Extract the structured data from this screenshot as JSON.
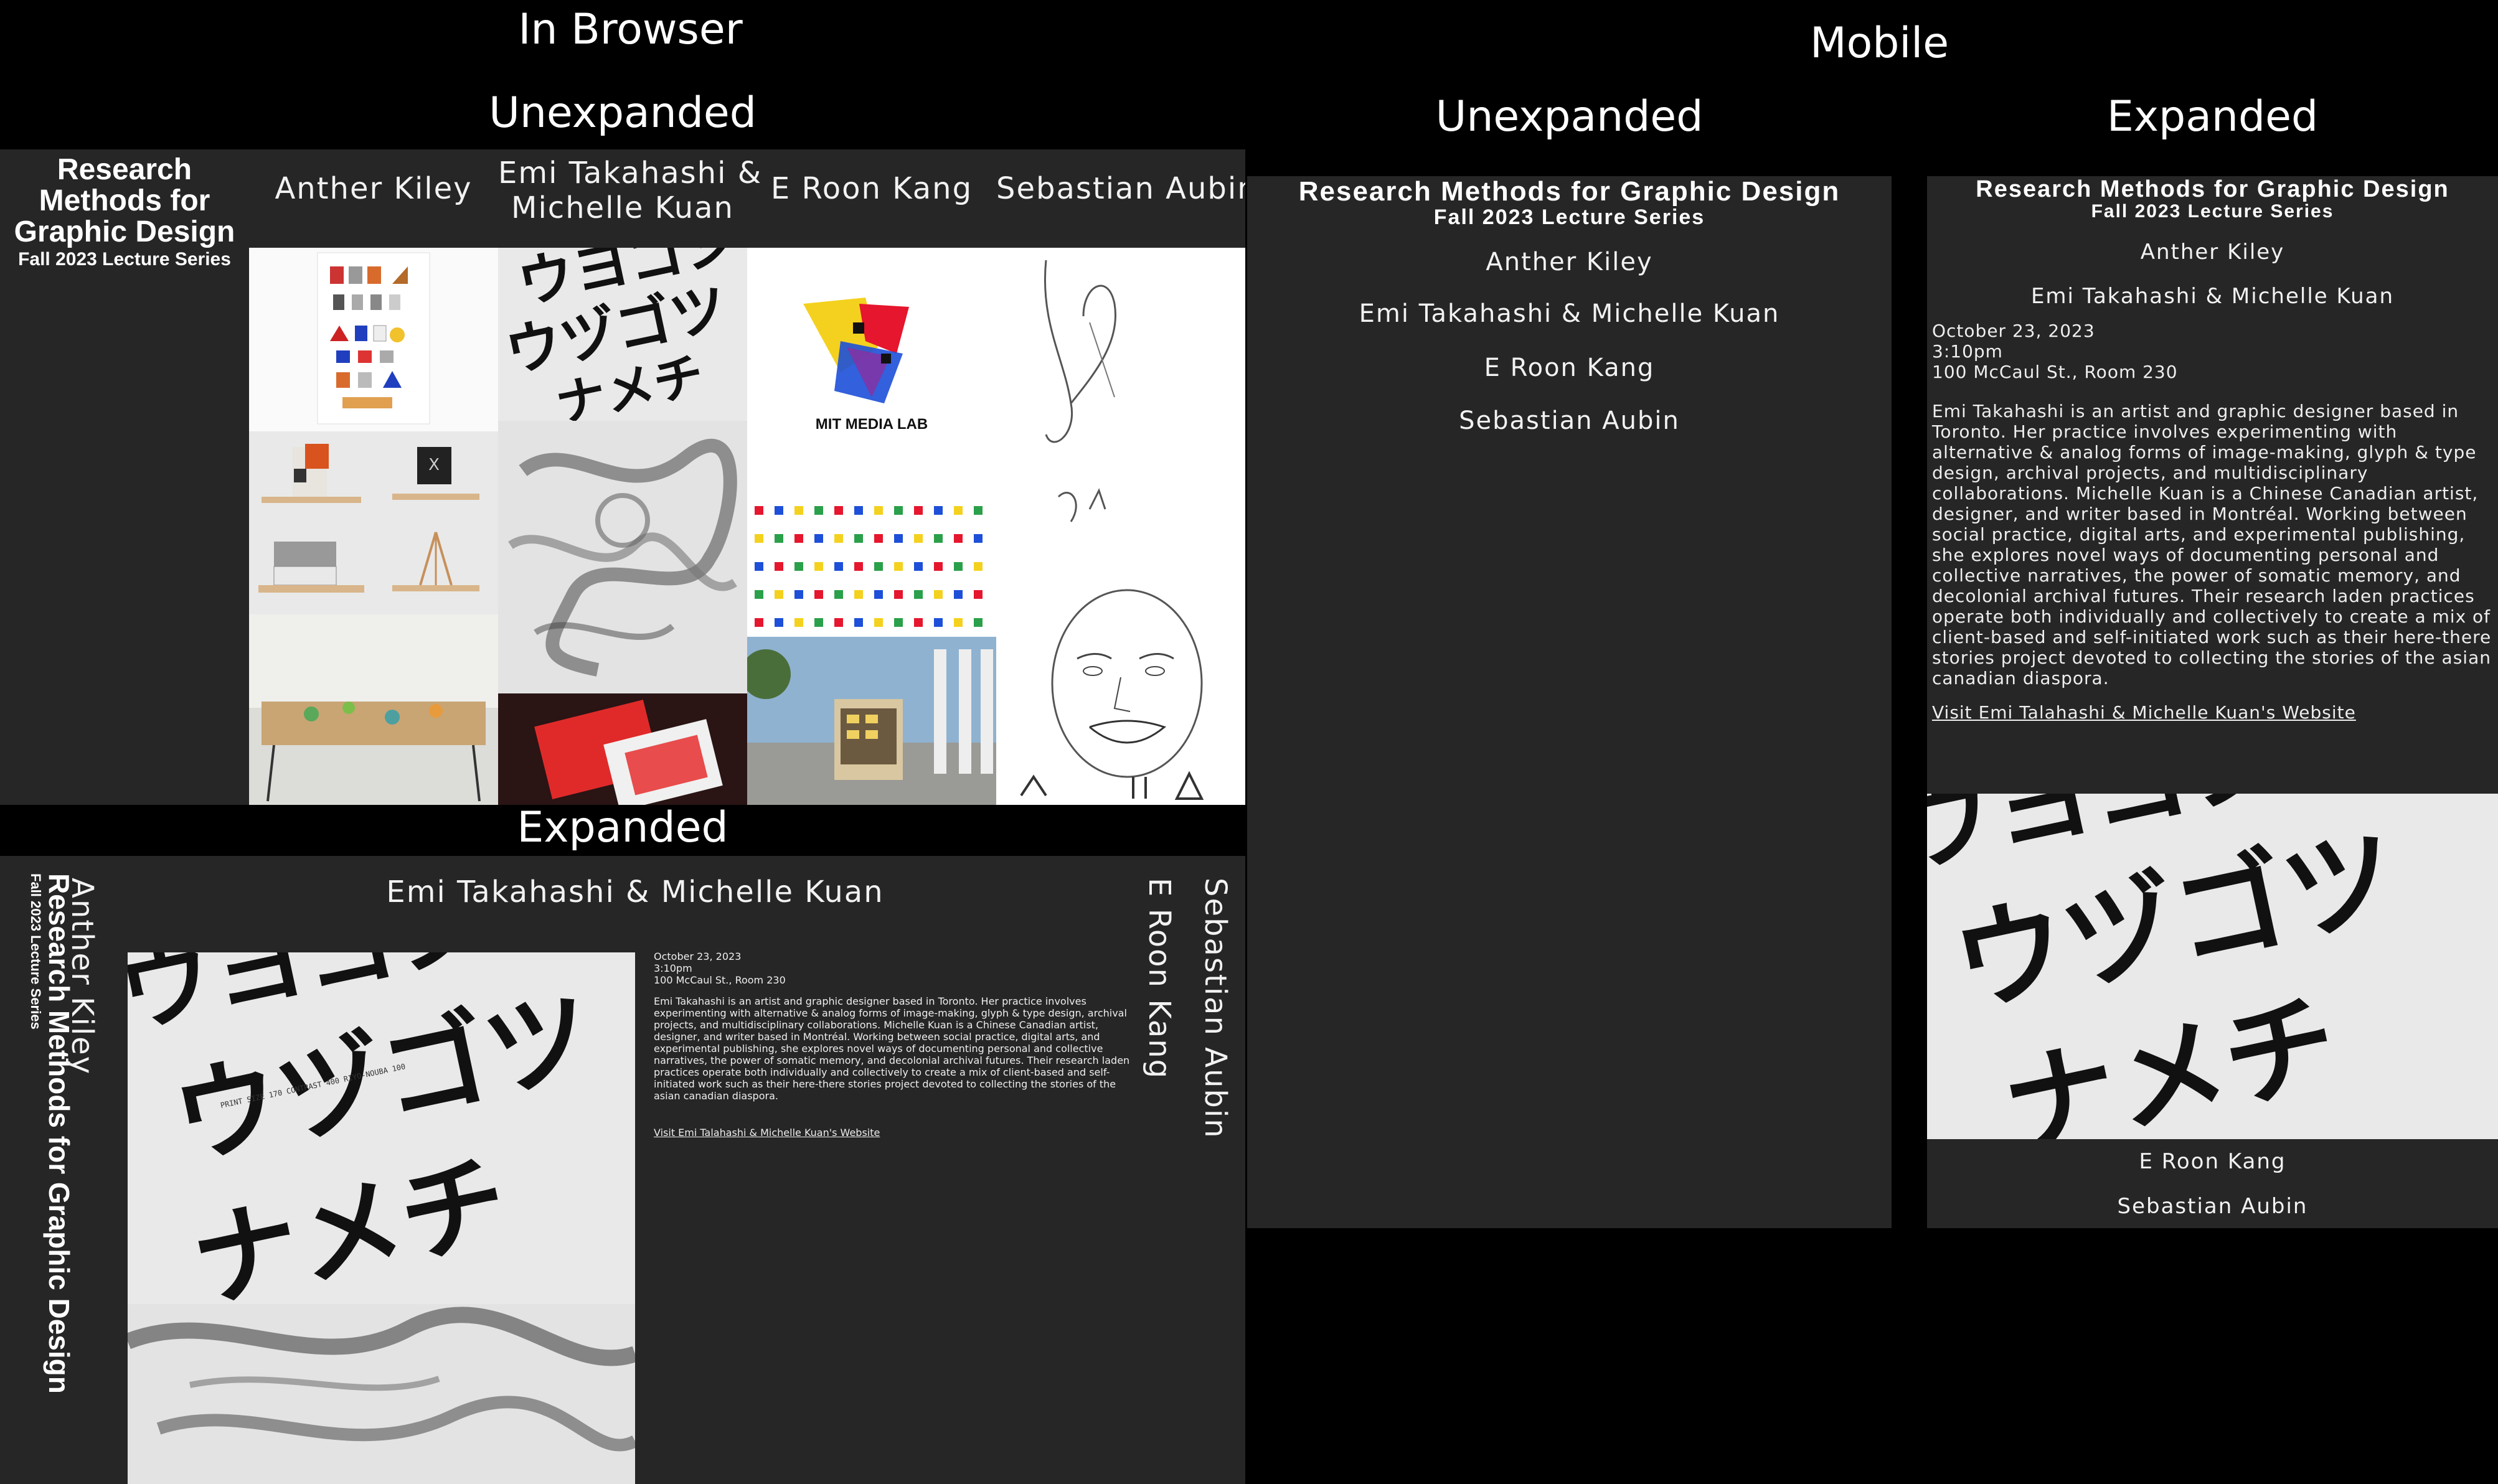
{
  "section_labels": {
    "in_browser": "In Browser",
    "mobile": "Mobile",
    "browser_unexpanded": "Unexpanded",
    "browser_expanded": "Expanded",
    "mobile_unexpanded": "Unexpanded",
    "mobile_expanded": "Expanded"
  },
  "site": {
    "title_lines": [
      "Research",
      "Methods for",
      "Graphic Design"
    ],
    "title_full": "Research Methods for Graphic Design",
    "subtitle": "Fall 2023 Lecture Series"
  },
  "speakers": {
    "s1": "Anther Kiley",
    "s2": "Emi Takahashi & Michelle Kuan",
    "s2_line1": "Emi Takahashi &",
    "s2_line2": "Michelle Kuan",
    "s3": "E Roon Kang",
    "s4": "Sebastian Aubin"
  },
  "event": {
    "date": "October 23, 2023",
    "time": "3:10pm",
    "location": "100 McCaul St., Room 230",
    "bio": "Emi Takahashi is an artist and graphic designer based in Toronto. Her practice involves experimenting with alternative & analog forms of image-making, glyph & type design, archival projects, and multidisciplinary collaborations. Michelle Kuan is a Chinese Canadian artist, designer, and writer based in Montréal. Working between social practice, digital arts, and experimental publishing, she explores novel ways of documenting personal and collective narratives, the power of somatic memory, and decolonial archival futures. Their research laden practices operate both individually and collectively to create a mix of client-based and self-initiated work such as their here-there stories project devoted to collecting the stories of the asian canadian diaspora.",
    "link": "Visit Emi Talahashi & Michelle Kuan's Website"
  },
  "logo_text": "MIT MEDIA LAB",
  "poster_small_text": "PRINT SIZE 170 CONTRAST 400 RIYO-NOUBA 100",
  "colors": {
    "panel": "#262626",
    "background": "#000000",
    "text": "#ffffff"
  }
}
